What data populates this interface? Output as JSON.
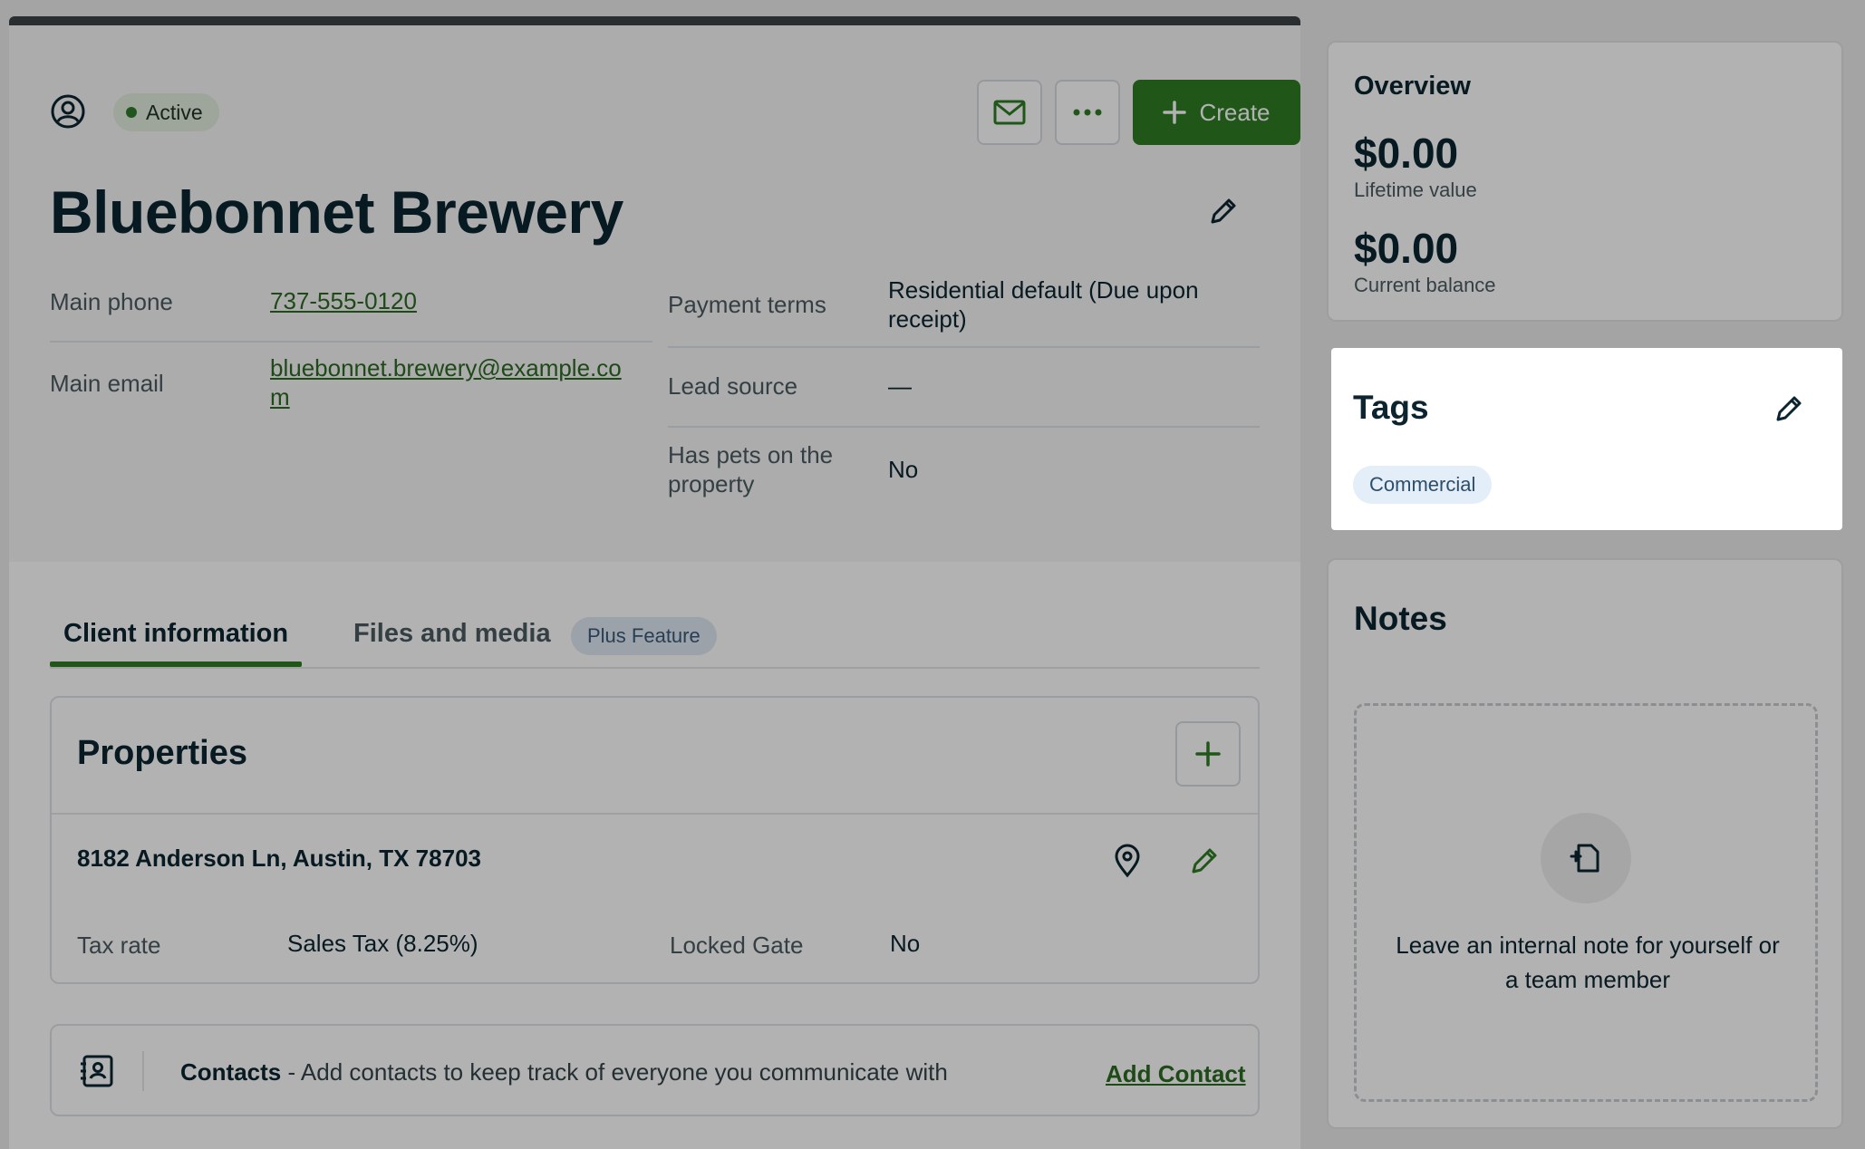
{
  "header": {
    "status": "Active",
    "create_label": "Create",
    "title": "Bluebonnet Brewery"
  },
  "fields": {
    "main_phone_label": "Main phone",
    "main_phone": "737-555-0120",
    "main_email_label": "Main email",
    "main_email_line1": "bluebonnet.brewery@example.co",
    "main_email_line2": "m",
    "payment_terms_label": "Payment terms",
    "payment_terms_line1": "Residential default (Due upon",
    "payment_terms_line2": "receipt)",
    "lead_source_label": "Lead source",
    "lead_source": "—",
    "pets_label_line1": "Has pets on the",
    "pets_label_line2": "property",
    "pets_value": "No"
  },
  "tabs": {
    "client_info": "Client information",
    "files_media": "Files and media",
    "plus_badge": "Plus Feature"
  },
  "properties": {
    "title": "Properties",
    "address": "8182 Anderson Ln, Austin, TX 78703",
    "tax_rate_label": "Tax rate",
    "tax_rate": "Sales Tax (8.25%)",
    "locked_gate_label": "Locked Gate",
    "locked_gate": "No"
  },
  "contacts": {
    "title": "Contacts",
    "description": " - Add contacts to keep track of everyone you communicate with",
    "add_label": "Add Contact"
  },
  "overview": {
    "title": "Overview",
    "lifetime_value": "$0.00",
    "lifetime_label": "Lifetime value",
    "current_balance": "$0.00",
    "balance_label": "Current balance"
  },
  "tags": {
    "title": "Tags",
    "items": [
      "Commercial"
    ]
  },
  "notes": {
    "title": "Notes",
    "empty_line1": "Leave an internal note for yourself or",
    "empty_line2": "a team member"
  },
  "colors": {
    "brand_green": "#2e7d25",
    "link_green": "#2a6a22",
    "text_dark": "#0b2430"
  }
}
